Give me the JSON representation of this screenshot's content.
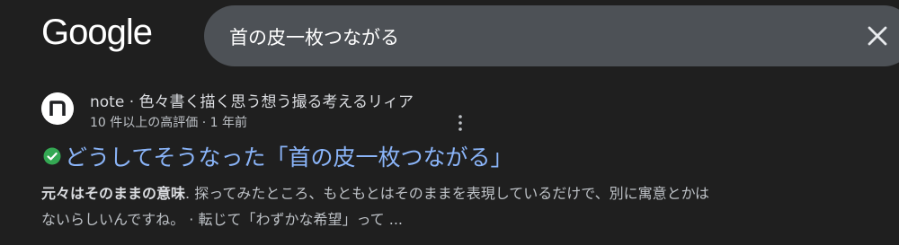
{
  "header": {
    "logo_text": "Google",
    "search": {
      "query": "首の皮一枚つながる",
      "clear_icon": "close-icon"
    }
  },
  "result": {
    "site_logo_letter": "n",
    "site_name": "note · 色々書く描く思う想う撮る考えるリィア",
    "meta": "10 件以上の高評価 · 1 年前",
    "title": "どうしてそうなった「首の皮一枚つながる」",
    "snippet": {
      "highlight": "元々はそのままの意味",
      "line1_rest": ". 探ってみたところ、もともとはそのままを表現しているだけで、別に寓意とかは",
      "line2": "ないらしいんですね。 · 転じて「わずかな希望」って ..."
    }
  },
  "colors": {
    "background": "#1f1f1f",
    "search_box": "#4d5156",
    "link": "#8ab4f8",
    "verified": "#34a853"
  }
}
